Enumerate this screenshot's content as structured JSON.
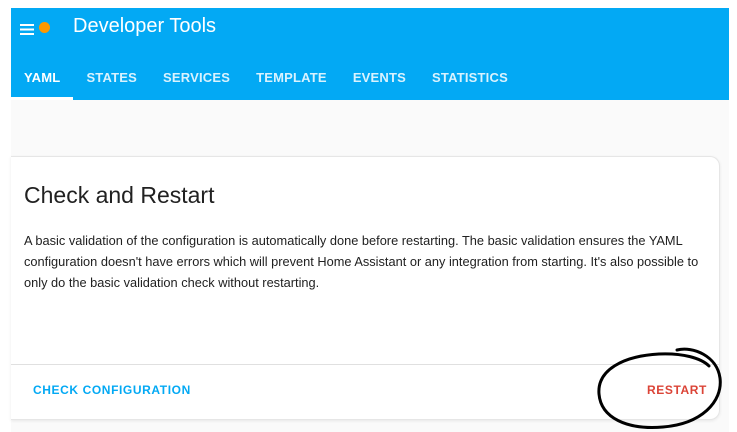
{
  "header": {
    "title": "Developer Tools",
    "menu_icon": "hamburger-menu-icon",
    "notification_color": "#ff9800",
    "background_color": "#03a9f4"
  },
  "tabs": [
    {
      "label": "YAML",
      "active": true
    },
    {
      "label": "STATES",
      "active": false
    },
    {
      "label": "SERVICES",
      "active": false
    },
    {
      "label": "TEMPLATE",
      "active": false
    },
    {
      "label": "EVENTS",
      "active": false
    },
    {
      "label": "STATISTICS",
      "active": false
    }
  ],
  "card": {
    "title": "Check and Restart",
    "description": "A basic validation of the configuration is automatically done before restarting. The basic validation ensures the YAML configuration doesn't have errors which will prevent Home Assistant or any integration from starting. It's also possible to only do the basic validation check without restarting.",
    "actions": {
      "check_label": "CHECK CONFIGURATION",
      "check_color": "#03a9f4",
      "restart_label": "RESTART",
      "restart_color": "#db4437"
    }
  },
  "annotation": {
    "shape": "hand-drawn-circle",
    "color": "#000000"
  }
}
